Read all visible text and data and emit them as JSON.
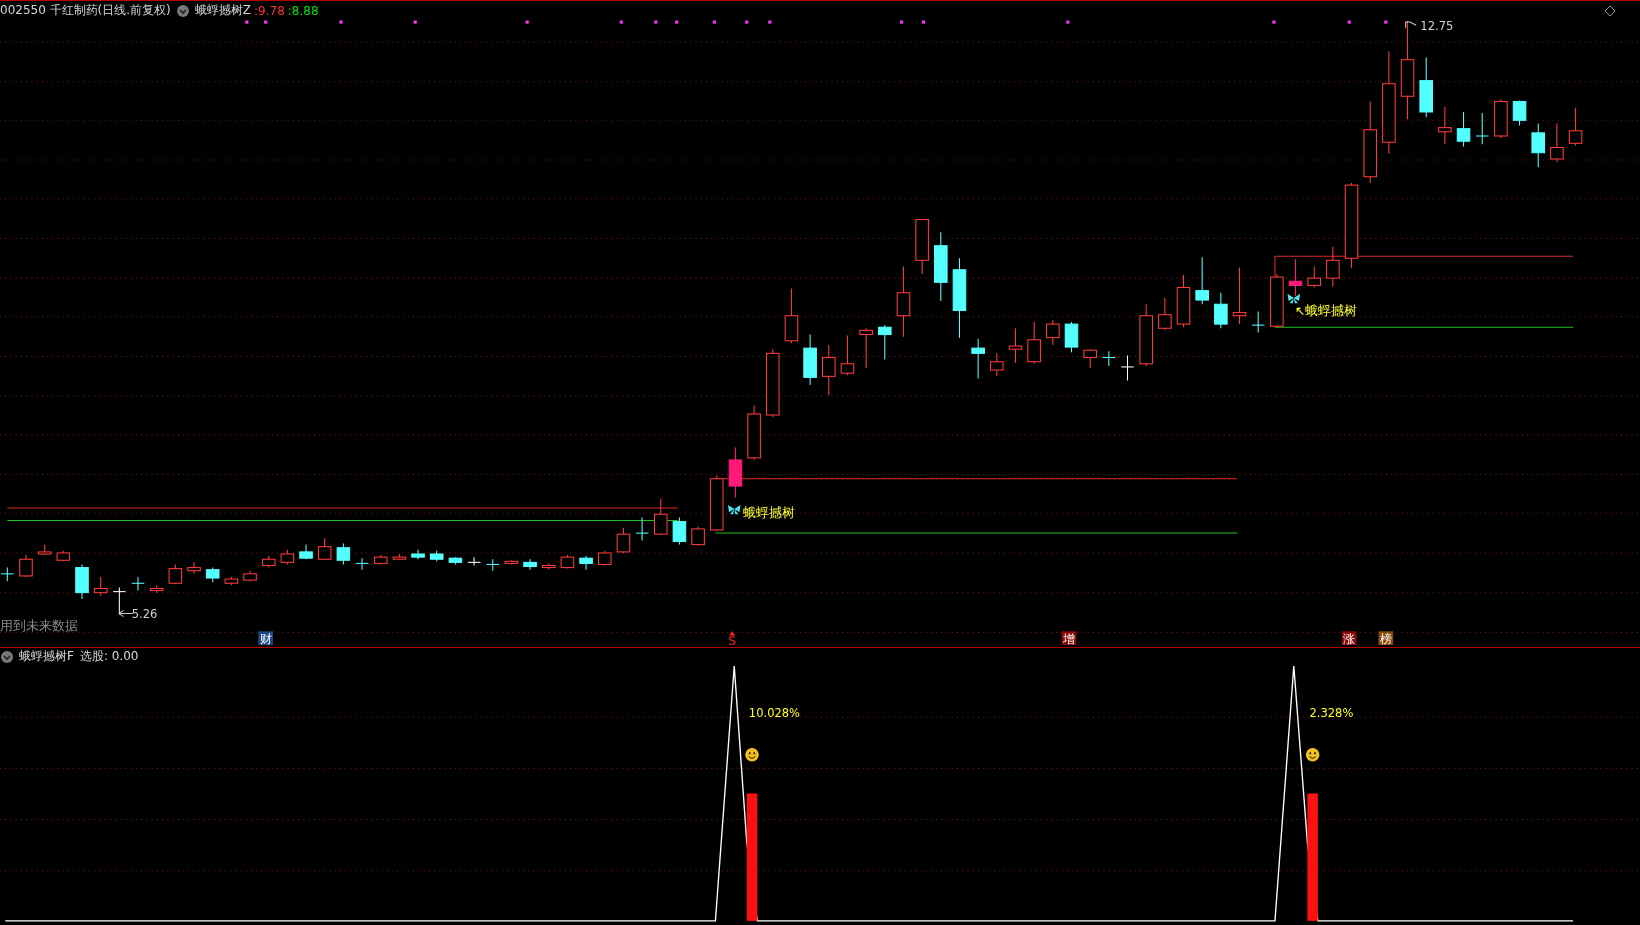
{
  "header": {
    "security": "002550 千红制药(日线.前复权)",
    "indicator": "蛾蜉撼树Z",
    "values": [
      {
        "text": ":9.78",
        "color": "#ff3232"
      },
      {
        "text": ":8.88",
        "color": "#00e600"
      }
    ]
  },
  "main_chart": {
    "high_label": "12.75",
    "low_label": "5.26",
    "note": "用到未来数据",
    "signals": [
      {
        "text": "蛾蜉撼树"
      },
      {
        "text": "↖蛾蜉撼树"
      }
    ],
    "events": [
      {
        "text": "财",
        "kind": "tag",
        "color": "#1c4a8a"
      },
      {
        "text": "S",
        "kind": "plain",
        "color": "#ff2020"
      },
      {
        "text": "增",
        "kind": "tag",
        "color": "#8b0a0a"
      },
      {
        "text": "涨",
        "kind": "tag",
        "color": "#8b0a0a"
      },
      {
        "text": "榜",
        "kind": "tag",
        "color": "#8a4a0a"
      }
    ]
  },
  "indicator_pane": {
    "title": "蛾蜉撼树F",
    "label": "选股: 0.00",
    "signals": [
      {
        "text": "10.028%"
      },
      {
        "text": "2.328%"
      }
    ]
  }
}
